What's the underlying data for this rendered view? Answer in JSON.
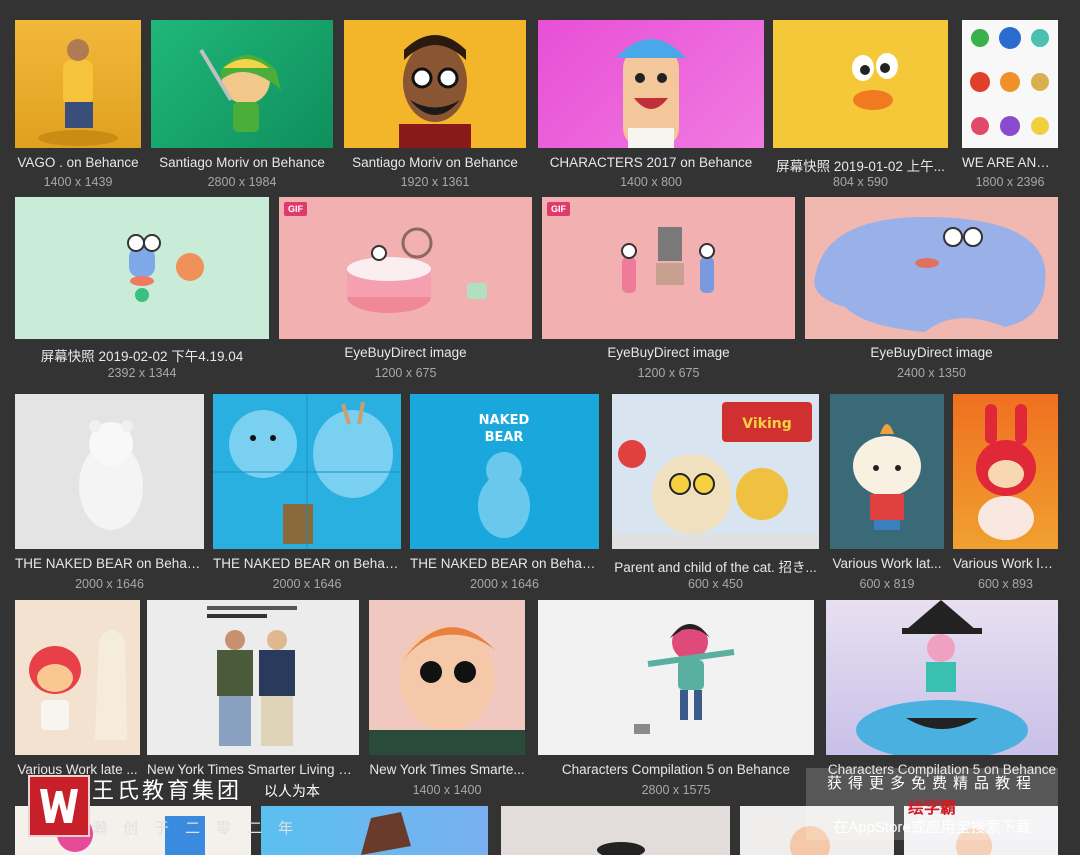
{
  "gallery": {
    "rows": [
      {
        "items": [
          {
            "caption": "VAGO . on Behance",
            "dims": "1400 x 1439"
          },
          {
            "caption": "Santiago Moriv on Behance",
            "dims": "2800 x 1984"
          },
          {
            "caption": "Santiago Moriv on Behance",
            "dims": "1920 x 1361"
          },
          {
            "caption": "CHARACTERS 2017 on Behance",
            "dims": "1400 x 800"
          },
          {
            "caption": "屏幕快照 2019-01-02 上午...",
            "dims": "804 x 590"
          },
          {
            "caption": "WE ARE ANTI...",
            "dims": "1800 x 2396"
          }
        ]
      },
      {
        "items": [
          {
            "caption": "屏幕快照 2019-02-02 下午4.19.04",
            "dims": "2392 x 1344"
          },
          {
            "caption": "EyeBuyDirect image",
            "dims": "1200 x 675",
            "badge": "GIF"
          },
          {
            "caption": "EyeBuyDirect image",
            "dims": "1200 x 675",
            "badge": "GIF"
          },
          {
            "caption": "EyeBuyDirect image",
            "dims": "2400 x 1350"
          }
        ]
      },
      {
        "items": [
          {
            "caption": "THE NAKED BEAR on Behance",
            "dims": "2000 x 1646"
          },
          {
            "caption": "THE NAKED BEAR on Behance",
            "dims": "2000 x 1646"
          },
          {
            "caption": "THE NAKED BEAR on Behance",
            "dims": "2000 x 1646"
          },
          {
            "caption": "Parent and child of the cat. 招き...",
            "dims": "600 x 450"
          },
          {
            "caption": "Various Work lat...",
            "dims": "600 x 819"
          },
          {
            "caption": "Various Work la...",
            "dims": "600 x 893"
          }
        ]
      },
      {
        "items": [
          {
            "caption": "Various Work late ...",
            "dims": ""
          },
          {
            "caption": "New York Times Smarter Living G...",
            "dims": ""
          },
          {
            "caption": "New York Times Smarte...",
            "dims": "1400 x 1400"
          },
          {
            "caption": "Characters Compilation 5 on Behance",
            "dims": "2800 x 1575"
          },
          {
            "caption": "Characters Compilation 5 on Behance",
            "dims": ""
          }
        ]
      }
    ]
  },
  "watermark_left": {
    "name": "王氏教育集团",
    "slogan": "以人为本",
    "sub": "瀚创于二零二年"
  },
  "watermark_right": {
    "line1": "获得更多免费精品教程",
    "line2": "绘学霸",
    "line3": "在AppStore或应用宝搜索下载"
  },
  "colors": {
    "background": "#333333",
    "gif_badge": "#e03a6a",
    "logo_red": "#c8202a"
  }
}
